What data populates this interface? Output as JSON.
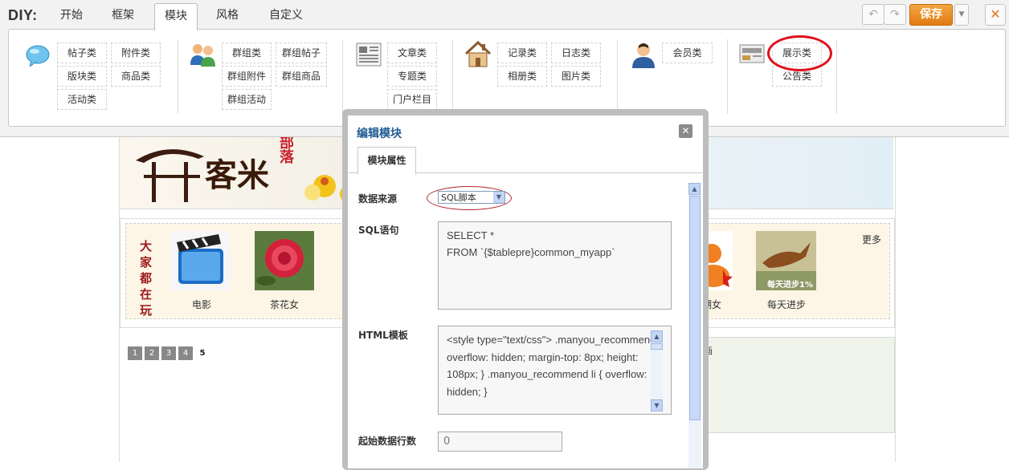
{
  "topbar": {
    "diy_label": "DIY:",
    "tabs": [
      {
        "label": "开始"
      },
      {
        "label": "框架"
      },
      {
        "label": "模块"
      },
      {
        "label": "风格"
      },
      {
        "label": "自定义"
      }
    ],
    "active_tab": "模块",
    "undo_icon": "undo-icon",
    "redo_icon": "redo-icon",
    "save_label": "保存",
    "close_icon": "close-icon",
    "accent_color": "#e68a1a"
  },
  "module_groups": [
    {
      "icon": "speech-bubble-icon",
      "items": [
        "帖子类",
        "附件类",
        "版块类",
        "商品类",
        "活动类"
      ]
    },
    {
      "icon": "users-group-icon",
      "items": [
        "群组类",
        "群组帖子",
        "群组附件",
        "群组商品",
        "群组活动"
      ]
    },
    {
      "icon": "newspaper-icon",
      "items": [
        "文章类",
        "专题类",
        "门户栏目"
      ]
    },
    {
      "icon": "house-icon",
      "items": [
        "记录类",
        "日志类",
        "相册类",
        "图片类"
      ]
    },
    {
      "icon": "member-icon",
      "items": [
        "会员类"
      ]
    },
    {
      "icon": "display-board-icon",
      "items": [
        "展示类",
        "公告类"
      ]
    }
  ],
  "background_page": {
    "banner_title": "客米",
    "banner_sub": "部落",
    "apps_vertical": "大家都在玩",
    "apps": [
      {
        "caption": "电影"
      },
      {
        "caption": "茶花女"
      },
      {
        "caption": "潮女"
      },
      {
        "caption": "每天进步"
      }
    ],
    "app_badge": "每天进步1%",
    "more_label": "更多",
    "pager": [
      "1",
      "2",
      "3",
      "4",
      "5"
    ],
    "right_box_text": "画"
  },
  "dialog": {
    "title": "编辑模块",
    "tab_label": "模块属性",
    "data_source_label": "数据来源",
    "data_source_value": "SQL脚本",
    "sql_label": "SQL语句",
    "sql_value": "SELECT *\nFROM `{$tablepre}common_myapp`",
    "html_label": "HTML模板",
    "html_value": "<style type=\"text/css\">\n.manyou_recommend { overflow: hidden; margin-top: 8px; height: 108px; }\n.manyou_recommend li { overflow: hidden; }",
    "start_rows_label": "起始数据行数",
    "start_rows_value": "0"
  }
}
